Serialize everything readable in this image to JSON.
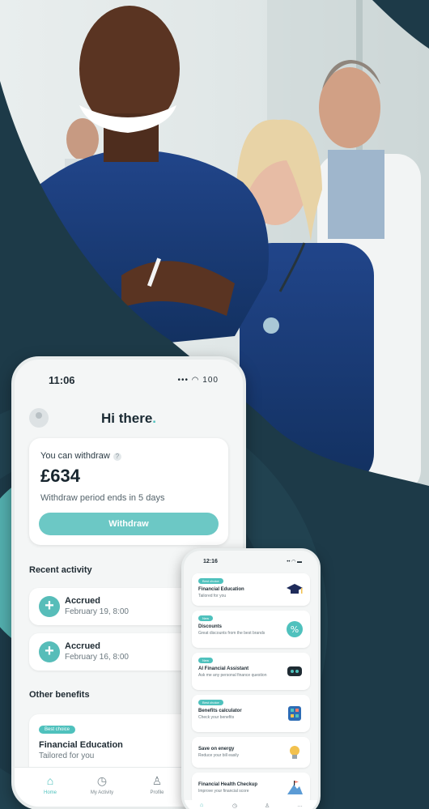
{
  "phone_main": {
    "time": "11:06",
    "system_icons": "••• ◠ 100",
    "greeting": "Hi there",
    "greeting_dot": ".",
    "withdraw_card": {
      "label": "You can withdraw",
      "info_glyph": "?",
      "amount": "£634",
      "period": "Withdraw period ends in 5 days",
      "button": "Withdraw"
    },
    "recent_activity": {
      "title": "Recent activity",
      "items": [
        {
          "title": "Accrued",
          "date": "February 19, 8:00",
          "icon": "plus-icon"
        },
        {
          "title": "Accrued",
          "date": "February 16, 8:00",
          "icon": "plus-icon"
        }
      ]
    },
    "other_benefits": {
      "title": "Other benefits",
      "card": {
        "tag": "Best choice",
        "title": "Financial Education",
        "subtitle": "Tailored for you"
      }
    },
    "nav": [
      {
        "label": "Home",
        "icon": "home-icon",
        "glyph": "⌂"
      },
      {
        "label": "My Activity",
        "icon": "clock-icon",
        "glyph": "◷"
      },
      {
        "label": "Profile",
        "icon": "person-icon",
        "glyph": "♙"
      }
    ]
  },
  "phone_secondary": {
    "time": "12:16",
    "system_icons": "•• ◠ ▬",
    "items": [
      {
        "tag": "Best choice",
        "title": "Financial Education",
        "subtitle": "Tailored for you",
        "icon": "graduation-cap-icon"
      },
      {
        "tag": "New",
        "title": "Discounts",
        "subtitle": "Great discounts from the best brands",
        "icon": "percent-badge-icon"
      },
      {
        "tag": "New",
        "title": "AI Financial Assistant",
        "subtitle": "Ask me any personal finance question",
        "icon": "chat-bot-icon"
      },
      {
        "tag": "Best choice",
        "title": "Benefits calculator",
        "subtitle": "Check your benefits",
        "icon": "calculator-icon"
      },
      {
        "tag": "",
        "title": "Save on energy",
        "subtitle": "Reduce your bill easily",
        "icon": "lightbulb-icon"
      },
      {
        "tag": "",
        "title": "Financial Health Checkup",
        "subtitle": "Improve your financial score",
        "icon": "mountain-flag-icon"
      }
    ],
    "nav_glyphs": [
      "⌂",
      "◷",
      "♙",
      "…"
    ]
  },
  "colors": {
    "accent": "#4fc1bd",
    "background_dark": "#1f3a48",
    "button": "#6cc8c5"
  }
}
